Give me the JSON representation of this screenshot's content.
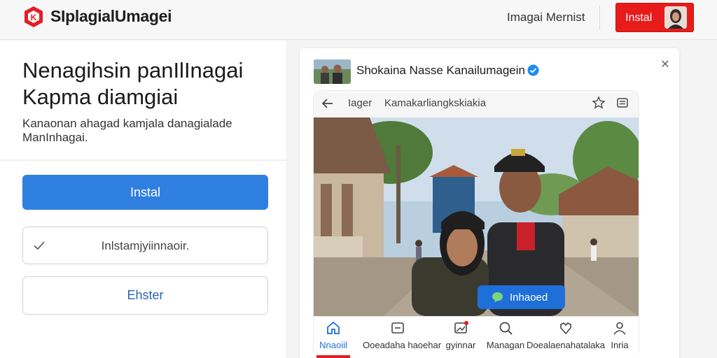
{
  "header": {
    "logo_icon": "app-logo-icon",
    "title": "SIplagialUmagei",
    "link": "Imagai Mernist",
    "install_label": "Instal"
  },
  "hero": {
    "headline_line1": "Nenagihsin panIlInagai",
    "headline_line2": "Kapma diamgiai",
    "subtext_line1": "Kanaonan ahagad kamjala danagialade",
    "subtext_line2": "ManInhagai."
  },
  "actions": {
    "primary_label": "Instal",
    "check_label": "Inlstamjyiinnaoir.",
    "outline_label": "Ehster"
  },
  "card": {
    "title": "Shokaina Nasse Kanailumagein",
    "verified_icon": "verified-badge-icon",
    "close_icon": "close-icon",
    "browser": {
      "url_prefix": "Iager",
      "url_text": "Kamakarliangkskiakia"
    },
    "overlay_button": "Inhaoed",
    "nav": [
      {
        "label": "Nnaoiil",
        "icon": "home-icon"
      },
      {
        "label": "Ooeadaha haoehar",
        "icon": "inbox-icon"
      },
      {
        "label": "gyinnar",
        "icon": "image-icon"
      },
      {
        "label": "Managan",
        "icon": "search-icon"
      },
      {
        "label": "Doealaenahatalaka",
        "icon": "heart-icon"
      },
      {
        "label": "Inria",
        "icon": "user-icon"
      }
    ]
  },
  "colors": {
    "accent_red": "#e81b1b",
    "primary_blue": "#2f7fe0",
    "link_blue": "#2a65b0"
  }
}
